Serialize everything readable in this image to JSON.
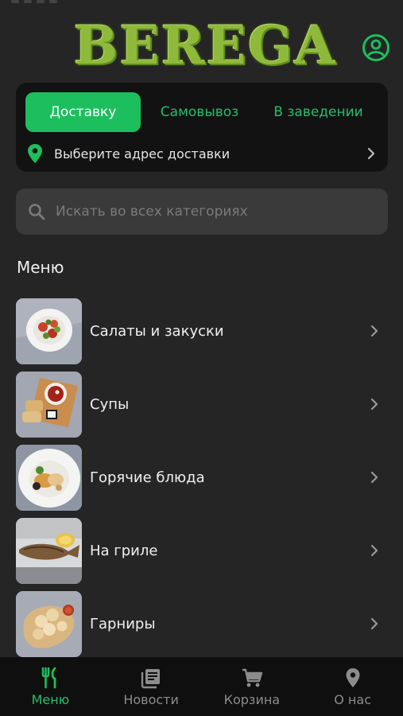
{
  "header": {
    "logo_text": "BEREGA",
    "profile_icon": "user-circle-icon"
  },
  "colors": {
    "accent": "#1dbe5d",
    "background": "#252525",
    "card": "#121212",
    "search_bg": "#3a3a3a",
    "nav_bg": "#0f0f0f",
    "logo_green": "#8fb93a"
  },
  "delivery": {
    "tabs": [
      {
        "label": "Доставку",
        "active": true
      },
      {
        "label": "Самовывоз",
        "active": false
      },
      {
        "label": "В заведении",
        "active": false
      }
    ],
    "address_icon": "map-pin-icon",
    "address_text": "Выберите адрес доставки"
  },
  "search": {
    "placeholder": "Искать во всех категориях",
    "value": ""
  },
  "menu": {
    "title": "Меню",
    "items": [
      {
        "label": "Салаты и закуски"
      },
      {
        "label": "Супы"
      },
      {
        "label": "Горячие блюда"
      },
      {
        "label": "На гриле"
      },
      {
        "label": "Гарниры"
      }
    ]
  },
  "bottom_nav": {
    "items": [
      {
        "label": "Меню",
        "icon": "fork-knife-icon",
        "active": true
      },
      {
        "label": "Новости",
        "icon": "news-icon",
        "active": false
      },
      {
        "label": "Корзина",
        "icon": "cart-icon",
        "active": false
      },
      {
        "label": "О нас",
        "icon": "location-icon",
        "active": false
      }
    ]
  }
}
